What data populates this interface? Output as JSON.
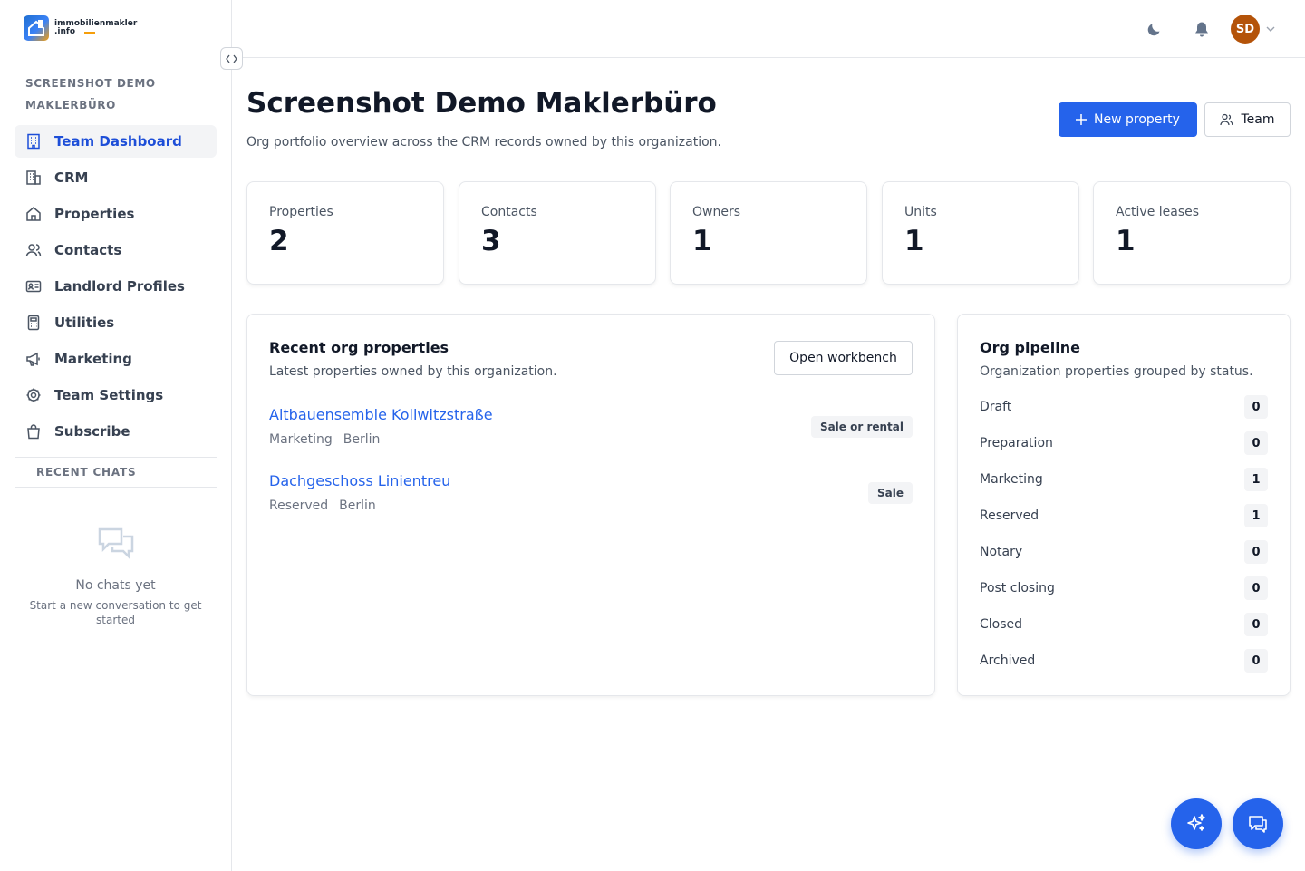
{
  "brand": {
    "line1": "immobilienmakler",
    "line2": ".info"
  },
  "sidebar": {
    "org_name": "SCREENSHOT DEMO MAKLERBÜRO",
    "items": [
      {
        "label": "Team Dashboard",
        "icon": "building-icon"
      },
      {
        "label": "CRM",
        "icon": "office-icon"
      },
      {
        "label": "Properties",
        "icon": "home-icon"
      },
      {
        "label": "Contacts",
        "icon": "users-icon"
      },
      {
        "label": "Landlord Profiles",
        "icon": "id-card-icon"
      },
      {
        "label": "Utilities",
        "icon": "calculator-icon"
      },
      {
        "label": "Marketing",
        "icon": "megaphone-icon"
      },
      {
        "label": "Team Settings",
        "icon": "gear-icon"
      },
      {
        "label": "Subscribe",
        "icon": "shopping-bag-icon"
      }
    ],
    "recent_chats_title": "RECENT CHATS",
    "empty_title": "No chats yet",
    "empty_sub": "Start a new conversation to get started"
  },
  "topbar": {
    "avatar_initials": "SD"
  },
  "header": {
    "title": "Screenshot Demo Maklerbüro",
    "subtitle": "Org portfolio overview across the CRM records owned by this organization.",
    "new_property_label": "New property",
    "team_label": "Team"
  },
  "stats": [
    {
      "label": "Properties",
      "value": "2"
    },
    {
      "label": "Contacts",
      "value": "3"
    },
    {
      "label": "Owners",
      "value": "1"
    },
    {
      "label": "Units",
      "value": "1"
    },
    {
      "label": "Active leases",
      "value": "1"
    }
  ],
  "recent": {
    "title": "Recent org properties",
    "subtitle": "Latest properties owned by this organization.",
    "workbench_label": "Open workbench",
    "properties": [
      {
        "name": "Altbauensemble Kollwitzstraße",
        "status": "Marketing",
        "city": "Berlin",
        "badge": "Sale or rental"
      },
      {
        "name": "Dachgeschoss Linientreu",
        "status": "Reserved",
        "city": "Berlin",
        "badge": "Sale"
      }
    ]
  },
  "pipeline": {
    "title": "Org pipeline",
    "subtitle": "Organization properties grouped by status.",
    "rows": [
      {
        "label": "Draft",
        "count": "0"
      },
      {
        "label": "Preparation",
        "count": "0"
      },
      {
        "label": "Marketing",
        "count": "1"
      },
      {
        "label": "Reserved",
        "count": "1"
      },
      {
        "label": "Notary",
        "count": "0"
      },
      {
        "label": "Post closing",
        "count": "0"
      },
      {
        "label": "Closed",
        "count": "0"
      },
      {
        "label": "Archived",
        "count": "0"
      }
    ]
  },
  "colors": {
    "accent": "#2563eb",
    "active_nav": "#1d4ed8",
    "avatar": "#b45309"
  }
}
